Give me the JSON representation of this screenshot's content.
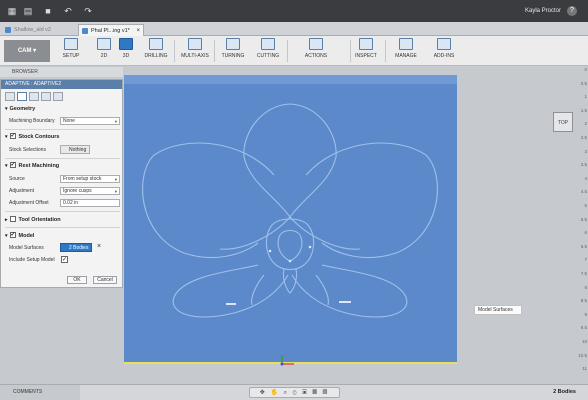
{
  "titlebar": {
    "user": "Kayla Proctor",
    "help": "?"
  },
  "tabs": [
    {
      "label": "Shallow_ald v2",
      "active": false
    },
    {
      "label": "Phal Pl...ing v1*",
      "active": true
    }
  ],
  "ribbon": {
    "workspace": "CAM",
    "groups": [
      "SETUP",
      "2D",
      "3D",
      "DRILLING",
      "MULTI-AXIS",
      "TURNING",
      "CUTTING",
      "ACTIONS",
      "INSPECT",
      "MANAGE",
      "ADD-INS"
    ]
  },
  "browser_label": "BROWSER",
  "panel": {
    "header": "ADAPTIVE : ADAPTIVE2",
    "geometry": {
      "title": "Geometry",
      "machining_boundary_label": "Machining Boundary",
      "machining_boundary_value": "None"
    },
    "stock_contours": {
      "title": "Stock Contours",
      "checked": true,
      "stock_selections_label": "Stock Selections",
      "stock_selections_value": "Nothing"
    },
    "rest_machining": {
      "title": "Rest Machining",
      "checked": true,
      "source_label": "Source",
      "source_value": "From setup stock",
      "adjustment_label": "Adjustment",
      "adjustment_value": "Ignore cusps",
      "adjustment_offset_label": "Adjustment Offset",
      "adjustment_offset_value": "0.02 in"
    },
    "tool_orientation": {
      "title": "Tool Orientation",
      "checked": false
    },
    "model": {
      "title": "Model",
      "checked": true,
      "model_surfaces_label": "Model Surfaces",
      "model_surfaces_value": "2 Bodies",
      "include_setup_model_label": "Include Setup Model",
      "include_setup_model_checked": true
    },
    "ok": "OK",
    "cancel": "Cancel"
  },
  "viewport": {
    "tooltip": "Model Surfaces",
    "viewcube": "TOP",
    "ruler_ticks": [
      "0",
      "0.5",
      "1",
      "1.5",
      "2",
      "2.5",
      "3",
      "3.5",
      "4",
      "4.5",
      "5",
      "5.5",
      "6",
      "6.5",
      "7",
      "7.5",
      "8",
      "8.5",
      "9",
      "9.5",
      "10",
      "10.5",
      "11"
    ]
  },
  "bottom": {
    "comments": "COMMENTS",
    "status": "2 Bodies"
  },
  "colors": {
    "stock_fill": "#5b89c9",
    "panel_header": "#5b7fa8",
    "accent": "#2f79c4"
  }
}
